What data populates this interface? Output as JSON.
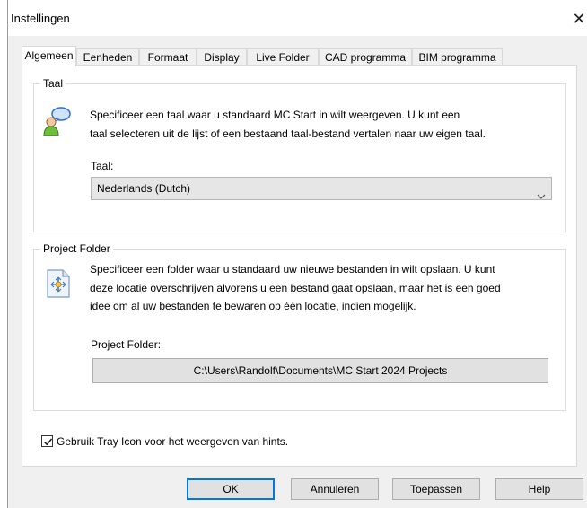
{
  "window": {
    "title": "Instellingen",
    "close_glyph": "✕"
  },
  "tabs": [
    {
      "label": "Algemeen",
      "active": true
    },
    {
      "label": "Eenheden",
      "active": false
    },
    {
      "label": "Formaat",
      "active": false
    },
    {
      "label": "Display",
      "active": false
    },
    {
      "label": "Live Folder",
      "active": false
    },
    {
      "label": "CAD programma",
      "active": false
    },
    {
      "label": "BIM programma",
      "active": false
    }
  ],
  "language_group": {
    "legend": "Taal",
    "icon": "language-users-icon",
    "description_line1": "Specificeer een taal waar u standaard MC Start in wilt weergeven. U kunt een",
    "description_line2": "taal selecteren uit de lijst of een bestaand taal-bestand vertalen naar uw eigen taal.",
    "field_label": "Taal:",
    "selected_value": "Nederlands (Dutch)"
  },
  "project_group": {
    "legend": "Project Folder",
    "icon": "folder-document-icon",
    "description_line1": "Specificeer een folder waar u standaard uw nieuwe bestanden in wilt opslaan. U kunt",
    "description_line2": "deze locatie overschrijven alvorens u een bestand gaat opslaan, maar het is een goed",
    "description_line3": "idee om al uw bestanden te bewaren op één locatie, indien mogelijk.",
    "field_label": "Project Folder:",
    "path_value": "C:\\Users\\Randolf\\Documents\\MC Start 2024 Projects"
  },
  "tray_option": {
    "label": "Gebruik Tray Icon voor het weergeven van hints.",
    "checked": true
  },
  "buttons": {
    "ok": "OK",
    "cancel": "Annuleren",
    "apply": "Toepassen",
    "help": "Help"
  },
  "colors": {
    "accent": "#0078d7",
    "dialog_bg": "#f0f0f0",
    "page_bg": "#ffffff"
  }
}
